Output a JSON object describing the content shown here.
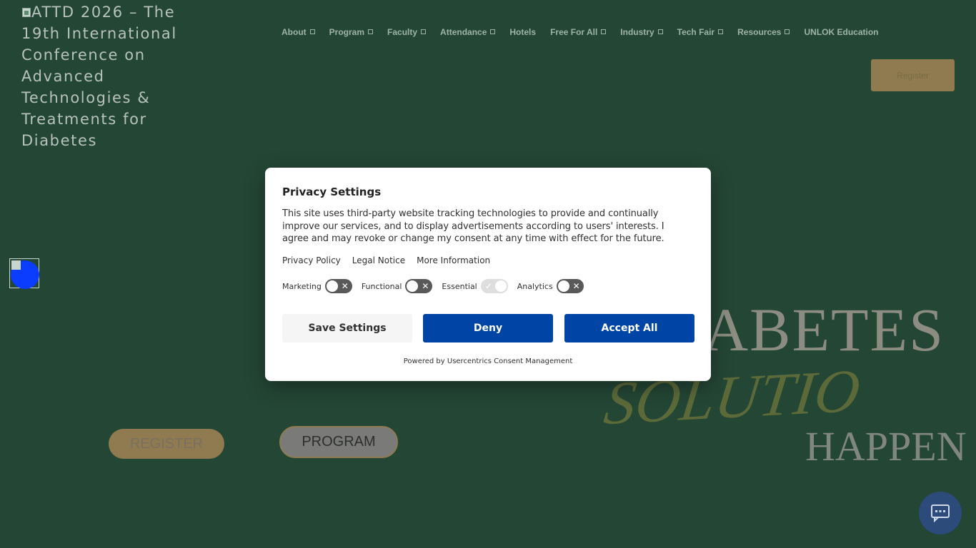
{
  "logo": {
    "alt_text": "ATTD 2026 – The 19th International Conference on Advanced Technologies & Treatments for Diabetes"
  },
  "nav": {
    "items": [
      {
        "label": "About",
        "has_dropdown": true
      },
      {
        "label": "Program",
        "has_dropdown": true
      },
      {
        "label": "Faculty",
        "has_dropdown": true
      },
      {
        "label": "Attendance",
        "has_dropdown": true
      },
      {
        "label": "Hotels",
        "has_dropdown": false
      },
      {
        "label": "Free For All",
        "has_dropdown": true
      },
      {
        "label": "Industry",
        "has_dropdown": true
      },
      {
        "label": "Tech Fair",
        "has_dropdown": true
      },
      {
        "label": "Resources",
        "has_dropdown": true
      },
      {
        "label": "UNLOK Education",
        "has_dropdown": false
      }
    ],
    "register_label": "Register"
  },
  "hero": {
    "word1": "ABETES",
    "word2": "SOLUTIO",
    "word3": "HAPPEN",
    "register_label": "REGISTER",
    "program_label": "PROGRAM"
  },
  "consent": {
    "title": "Privacy Settings",
    "description": "This site uses third-party website tracking technologies to provide and continually improve our services, and to display advertisements according to users' interests. I agree and may revoke or change my consent at any time with effect for the future.",
    "links": {
      "privacy_policy": "Privacy Policy",
      "legal_notice": "Legal Notice",
      "more_information": "More Information"
    },
    "toggles": [
      {
        "label": "Marketing",
        "state": "off"
      },
      {
        "label": "Functional",
        "state": "off"
      },
      {
        "label": "Essential",
        "state": "on"
      },
      {
        "label": "Analytics",
        "state": "off"
      }
    ],
    "buttons": {
      "save": "Save Settings",
      "deny": "Deny",
      "accept": "Accept All"
    },
    "powered_by": "Powered by Usercentrics Consent Management"
  },
  "colors": {
    "background": "#244635",
    "gold": "#8f7b4f",
    "consent_primary": "#0045a5"
  }
}
